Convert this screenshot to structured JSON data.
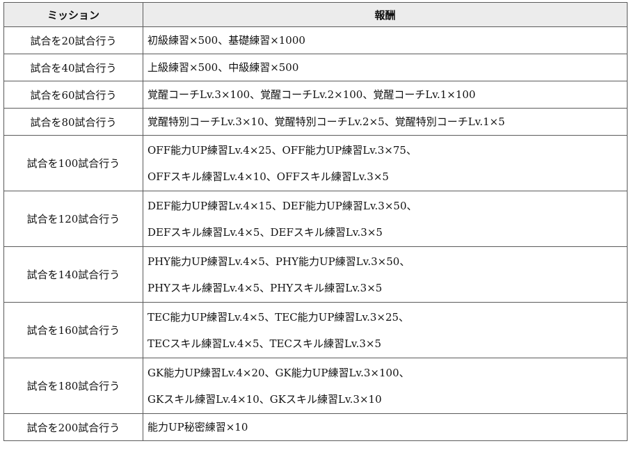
{
  "table": {
    "headers": {
      "mission": "ミッション",
      "reward": "報酬"
    },
    "rows": [
      {
        "mission": "試合を20試合行う",
        "reward": [
          "初級練習×500、基礎練習×1000"
        ]
      },
      {
        "mission": "試合を40試合行う",
        "reward": [
          "上級練習×500、中級練習×500"
        ]
      },
      {
        "mission": "試合を60試合行う",
        "reward": [
          "覚醒コーチLv.3×100、覚醒コーチLv.2×100、覚醒コーチLv.1×100"
        ]
      },
      {
        "mission": "試合を80試合行う",
        "reward": [
          "覚醒特別コーチLv.3×10、覚醒特別コーチLv.2×5、覚醒特別コーチLv.1×5"
        ]
      },
      {
        "mission": "試合を100試合行う",
        "reward": [
          "OFF能力UP練習Lv.4×25、OFF能力UP練習Lv.3×75、",
          "OFFスキル練習Lv.4×10、OFFスキル練習Lv.3×5"
        ]
      },
      {
        "mission": "試合を120試合行う",
        "reward": [
          "DEF能力UP練習Lv.4×15、DEF能力UP練習Lv.3×50、",
          "DEFスキル練習Lv.4×5、DEFスキル練習Lv.3×5"
        ]
      },
      {
        "mission": "試合を140試合行う",
        "reward": [
          "PHY能力UP練習Lv.4×5、PHY能力UP練習Lv.3×50、",
          "PHYスキル練習Lv.4×5、PHYスキル練習Lv.3×5"
        ]
      },
      {
        "mission": "試合を160試合行う",
        "reward": [
          "TEC能力UP練習Lv.4×5、TEC能力UP練習Lv.3×25、",
          "TECスキル練習Lv.4×5、TECスキル練習Lv.3×5"
        ]
      },
      {
        "mission": "試合を180試合行う",
        "reward": [
          "GK能力UP練習Lv.4×20、GK能力UP練習Lv.3×100、",
          "GKスキル練習Lv.4×10、GKスキル練習Lv.3×10"
        ]
      },
      {
        "mission": "試合を200試合行う",
        "reward": [
          "能力UP秘密練習×10"
        ]
      }
    ]
  }
}
